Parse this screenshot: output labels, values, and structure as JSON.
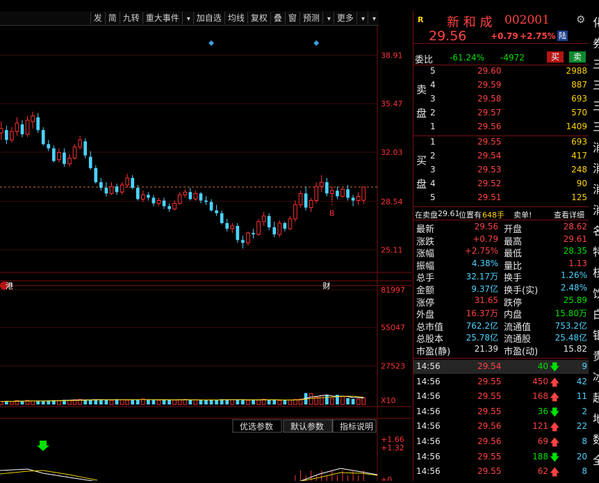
{
  "toolbar": {
    "items": [
      "发",
      "简",
      "九转",
      "重大事件",
      "",
      "加自选",
      "均线",
      "复权",
      "叠",
      "窗",
      "预测",
      "",
      "更多",
      "",
      ""
    ]
  },
  "price_axis": [
    "38.91",
    "35.47",
    "32.03",
    "28.54",
    "25.11"
  ],
  "volume_axis": [
    "81997",
    "55047",
    "27523"
  ],
  "volume_unit": "X10",
  "macd_axis": [
    "+1.66",
    "+1.32",
    "+0"
  ],
  "markers": {
    "hk": "港",
    "fin": "财",
    "buy": "B"
  },
  "indicator_buttons": [
    "优选参数",
    "默认参数",
    "指标说明"
  ],
  "stock": {
    "badge": "R",
    "name": "新 和 成",
    "code": "002001",
    "price": "29.56",
    "change": "+0.79",
    "pct": "+2.75%",
    "tag": "陆"
  },
  "commission": {
    "label": "委比",
    "ratio": "-61.24%",
    "diff": "-4972",
    "buy_btn": "买",
    "sell_btn": "卖"
  },
  "asks": {
    "side_label": [
      "卖",
      "盘"
    ],
    "rows": [
      {
        "lvl": "5",
        "price": "29.60",
        "vol": "2988"
      },
      {
        "lvl": "4",
        "price": "29.59",
        "vol": "887"
      },
      {
        "lvl": "3",
        "price": "29.58",
        "vol": "693"
      },
      {
        "lvl": "2",
        "price": "29.57",
        "vol": "570"
      },
      {
        "lvl": "1",
        "price": "29.56",
        "vol": "1409"
      }
    ]
  },
  "bids": {
    "side_label": [
      "买",
      "盘"
    ],
    "rows": [
      {
        "lvl": "1",
        "price": "29.55",
        "vol": "693"
      },
      {
        "lvl": "2",
        "price": "29.54",
        "vol": "417"
      },
      {
        "lvl": "3",
        "price": "29.53",
        "vol": "248"
      },
      {
        "lvl": "4",
        "price": "29.52",
        "vol": "90"
      },
      {
        "lvl": "5",
        "price": "29.51",
        "vol": "125"
      }
    ]
  },
  "notice": {
    "prefix": "在卖盘",
    "price": "29.61",
    "mid": "位置有",
    "vol": "648手",
    "suffix": "卖单!",
    "link": "查看详细"
  },
  "stats": [
    {
      "l1": "最新",
      "v1": "29.56",
      "c1": "red",
      "l2": "开盘",
      "v2": "28.62",
      "c2": "red"
    },
    {
      "l1": "涨跌",
      "v1": "+0.79",
      "c1": "red",
      "l2": "最高",
      "v2": "29.61",
      "c2": "red"
    },
    {
      "l1": "涨幅",
      "v1": "+2.75%",
      "c1": "red",
      "l2": "最低",
      "v2": "28.35",
      "c2": "green"
    },
    {
      "l1": "振幅",
      "v1": "4.38%",
      "c1": "cyan",
      "l2": "量比",
      "v2": "1.13",
      "c2": "red"
    },
    {
      "l1": "总手",
      "v1": "32.17万",
      "c1": "cyan",
      "l2": "换手",
      "v2": "1.26%",
      "c2": "cyan"
    },
    {
      "l1": "金额",
      "v1": "9.37亿",
      "c1": "cyan",
      "l2": "换手(实)",
      "v2": "2.48%",
      "c2": "cyan"
    },
    {
      "l1": "涨停",
      "v1": "31.65",
      "c1": "red",
      "l2": "跌停",
      "v2": "25.89",
      "c2": "green"
    },
    {
      "l1": "外盘",
      "v1": "16.37万",
      "c1": "red",
      "l2": "内盘",
      "v2": "15.80万",
      "c2": "green"
    },
    {
      "l1": "总市值",
      "v1": "762.2亿",
      "c1": "cyan",
      "l2": "流通值",
      "v2": "753.2亿",
      "c2": "cyan"
    },
    {
      "l1": "总股本",
      "v1": "25.78亿",
      "c1": "cyan",
      "l2": "流通股",
      "v2": "25.48亿",
      "c2": "cyan"
    },
    {
      "l1": "市盈(静)",
      "v1": "21.39",
      "c1": "white",
      "l2": "市盈(动)",
      "v2": "15.82",
      "c2": "white"
    }
  ],
  "ticks": [
    {
      "time": "14:56",
      "price": "29.54",
      "vol": "40",
      "dir": "down",
      "n": "9"
    },
    {
      "time": "14:56",
      "price": "29.55",
      "vol": "450",
      "dir": "up",
      "n": "42"
    },
    {
      "time": "14:56",
      "price": "29.55",
      "vol": "168",
      "dir": "up",
      "n": "11"
    },
    {
      "time": "14:56",
      "price": "29.55",
      "vol": "36",
      "dir": "down",
      "n": "2"
    },
    {
      "time": "14:56",
      "price": "29.56",
      "vol": "121",
      "dir": "up",
      "n": "22"
    },
    {
      "time": "14:56",
      "price": "29.56",
      "vol": "69",
      "dir": "up",
      "n": "8"
    },
    {
      "time": "14:56",
      "price": "29.55",
      "vol": "188",
      "dir": "down",
      "n": "20"
    },
    {
      "time": "14:56",
      "price": "29.55",
      "vol": "62",
      "dir": "up",
      "n": "8"
    }
  ],
  "farright_text": [
    "化",
    "券",
    "三",
    "三",
    "三",
    "三",
    "消",
    "消",
    "消",
    "消",
    "名",
    "特",
    "核",
    "饮",
    "白",
    "银",
    "贵",
    "冰",
    "超",
    "地",
    "数",
    "全"
  ],
  "colors": {
    "up": "#ff3232",
    "down": "#4bd2ff",
    "accent_red": "#7a1010",
    "yellow": "#ffd400"
  },
  "chart_data": {
    "type": "candlestick",
    "price_ticks": [
      38.91,
      35.47,
      32.03,
      28.54,
      25.11
    ],
    "ylim": [
      23.5,
      41.0
    ],
    "reference_price": 29.56,
    "candles": [
      [
        33.4,
        34.2,
        32.9,
        33.7
      ],
      [
        33.6,
        33.9,
        32.6,
        32.9
      ],
      [
        32.9,
        33.8,
        32.7,
        33.5
      ],
      [
        33.5,
        34.5,
        33.2,
        34.1
      ],
      [
        34.0,
        34.3,
        33.1,
        33.3
      ],
      [
        33.3,
        34.6,
        33.1,
        34.3
      ],
      [
        34.2,
        34.9,
        33.7,
        34.6
      ],
      [
        34.5,
        34.8,
        33.4,
        33.6
      ],
      [
        33.6,
        33.8,
        32.5,
        32.6
      ],
      [
        32.6,
        32.9,
        32.1,
        32.3
      ],
      [
        32.3,
        32.5,
        31.3,
        31.4
      ],
      [
        31.5,
        32.3,
        31.3,
        32.0
      ],
      [
        32.0,
        32.3,
        31.0,
        31.2
      ],
      [
        31.2,
        31.9,
        31.0,
        31.6
      ],
      [
        31.6,
        32.6,
        31.5,
        32.4
      ],
      [
        32.4,
        33.2,
        32.2,
        32.9
      ],
      [
        32.8,
        33.0,
        31.6,
        31.8
      ],
      [
        31.7,
        32.1,
        30.8,
        30.9
      ],
      [
        30.9,
        31.1,
        29.8,
        29.9
      ],
      [
        29.9,
        30.2,
        29.3,
        29.5
      ],
      [
        29.5,
        29.9,
        28.9,
        29.1
      ],
      [
        29.1,
        29.9,
        29.0,
        29.6
      ],
      [
        29.6,
        29.8,
        29.0,
        29.2
      ],
      [
        29.2,
        29.9,
        29.0,
        29.7
      ],
      [
        29.7,
        30.5,
        29.5,
        30.2
      ],
      [
        30.2,
        30.4,
        29.4,
        29.5
      ],
      [
        29.5,
        29.7,
        28.6,
        28.7
      ],
      [
        28.7,
        29.3,
        28.5,
        29.0
      ],
      [
        29.0,
        29.2,
        28.6,
        28.8
      ],
      [
        28.8,
        29.0,
        28.2,
        28.4
      ],
      [
        28.4,
        28.8,
        28.2,
        28.6
      ],
      [
        28.6,
        28.8,
        28.0,
        28.2
      ],
      [
        28.2,
        28.4,
        27.8,
        28.0
      ],
      [
        28.0,
        28.6,
        27.9,
        28.4
      ],
      [
        28.4,
        29.2,
        28.3,
        29.0
      ],
      [
        29.0,
        29.4,
        28.8,
        29.2
      ],
      [
        29.2,
        29.5,
        28.6,
        28.7
      ],
      [
        28.7,
        29.3,
        28.6,
        29.1
      ],
      [
        29.1,
        29.2,
        28.4,
        28.6
      ],
      [
        28.6,
        28.9,
        28.3,
        28.5
      ],
      [
        28.5,
        28.7,
        27.8,
        27.9
      ],
      [
        27.9,
        28.3,
        27.5,
        27.7
      ],
      [
        27.7,
        27.9,
        26.9,
        27.0
      ],
      [
        27.0,
        27.3,
        26.4,
        26.6
      ],
      [
        26.6,
        27.0,
        26.3,
        26.8
      ],
      [
        26.8,
        27.0,
        25.6,
        25.8
      ],
      [
        25.8,
        26.1,
        25.2,
        25.6
      ],
      [
        25.6,
        26.4,
        25.4,
        26.3
      ],
      [
        26.3,
        26.6,
        25.9,
        26.2
      ],
      [
        26.2,
        27.3,
        26.1,
        27.1
      ],
      [
        27.1,
        27.8,
        26.8,
        27.5
      ],
      [
        27.5,
        27.7,
        26.5,
        26.7
      ],
      [
        26.7,
        27.1,
        26.0,
        26.2
      ],
      [
        26.2,
        27.2,
        26.0,
        27.0
      ],
      [
        27.0,
        27.1,
        26.4,
        26.6
      ],
      [
        26.6,
        27.5,
        26.5,
        27.3
      ],
      [
        27.3,
        28.6,
        27.1,
        28.3
      ],
      [
        28.3,
        29.3,
        28.1,
        29.1
      ],
      [
        29.1,
        29.6,
        27.9,
        28.1
      ],
      [
        28.1,
        28.8,
        27.8,
        28.6
      ],
      [
        28.6,
        29.9,
        28.4,
        29.6
      ],
      [
        29.6,
        30.4,
        29.2,
        29.9
      ],
      [
        29.9,
        30.2,
        28.9,
        29.1
      ],
      [
        29.1,
        29.6,
        28.6,
        29.3
      ],
      [
        29.3,
        29.6,
        28.7,
        28.9
      ],
      [
        28.9,
        29.5,
        28.8,
        29.4
      ],
      [
        29.4,
        29.7,
        28.6,
        28.8
      ],
      [
        28.8,
        29.0,
        28.2,
        28.6
      ],
      [
        28.6,
        29.2,
        28.3,
        28.9
      ],
      [
        28.62,
        29.61,
        28.35,
        29.56
      ]
    ],
    "volume_ticks": [
      81997,
      55047,
      27523
    ],
    "volume_max": 82000,
    "volumes": [
      2100,
      2500,
      2200,
      2700,
      2300,
      2900,
      2500,
      2400,
      2600,
      2800,
      3100,
      2900,
      3300,
      3000,
      3400,
      3600,
      3200,
      3500,
      3700,
      3300,
      3400,
      3000,
      3800,
      3500,
      3100,
      3600,
      3300,
      3900,
      3400,
      3200,
      3000,
      3500,
      3300,
      3200,
      3400,
      3600,
      3100,
      3300,
      3000,
      3200,
      3400,
      3100,
      3800,
      3600,
      3300,
      3500,
      3300,
      2900,
      3400,
      3100,
      3700,
      3200,
      3400,
      2900,
      3100,
      3300,
      3600,
      3900,
      8200,
      7700,
      5200,
      6300,
      6800,
      4100,
      6900,
      5600,
      4500,
      4000,
      3900,
      4800
    ],
    "macd_ticks": [
      1.66,
      1.32,
      0
    ]
  }
}
